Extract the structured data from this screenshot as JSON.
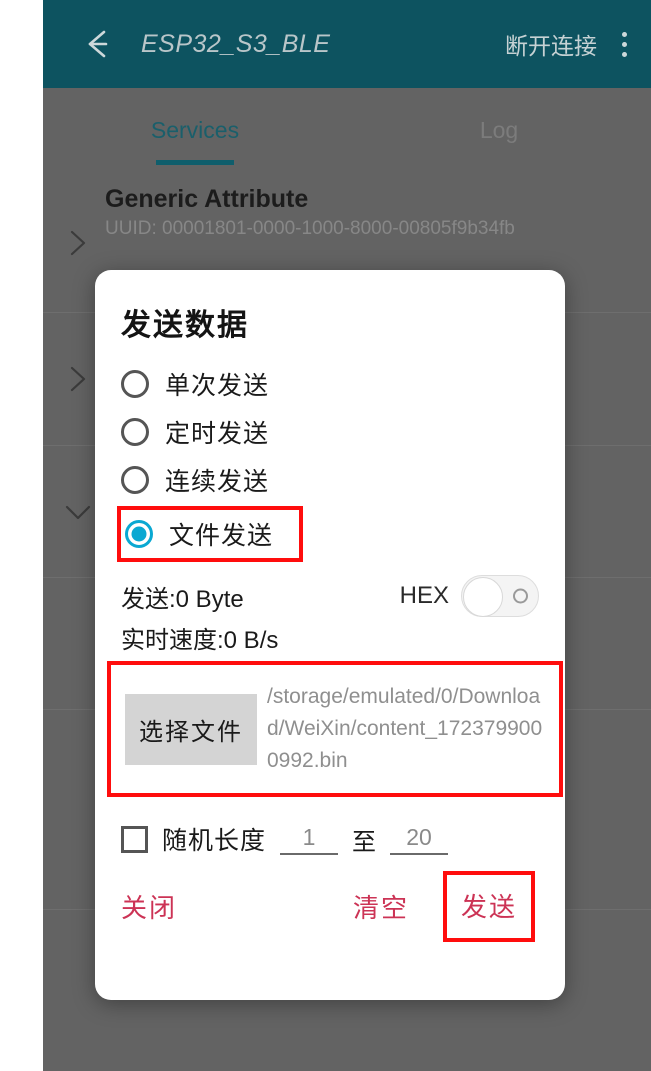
{
  "appbar": {
    "back_icon": "arrow-left-icon",
    "title": "ESP32_S3_BLE",
    "action_label": "断开连接",
    "overflow_icon": "more-vertical-icon"
  },
  "tabs": [
    {
      "label": "Services",
      "active": true
    },
    {
      "label": "Log",
      "active": false
    }
  ],
  "services": [
    {
      "name": "Generic Attribute",
      "uuid": "UUID: 00001801-0000-1000-8000-00805f9b34fb",
      "chevron": "chevron-right-icon"
    },
    {
      "name": "",
      "uuid": "",
      "chevron": "chevron-right-icon"
    },
    {
      "name": "",
      "uuid": "",
      "chevron": "chevron-down-icon"
    },
    {
      "name": "",
      "uuid": "",
      "chevron": ""
    }
  ],
  "dialog": {
    "title": "发送数据",
    "modes": [
      {
        "label": "单次发送",
        "selected": false
      },
      {
        "label": "定时发送",
        "selected": false
      },
      {
        "label": "连续发送",
        "selected": false
      },
      {
        "label": "文件发送",
        "selected": true
      }
    ],
    "sent_label": "发送:0 Byte",
    "hex_label": "HEX",
    "hex_enabled": false,
    "speed_label": "实时速度:0 B/s",
    "file_picker_label": "选择文件",
    "file_path": "/storage/emulated/0/Download/WeiXin/content_1723799000992.bin",
    "random_length_label": "随机长度",
    "random_length_checked": false,
    "random_min": "1",
    "random_to": "至",
    "random_max": "20",
    "close_label": "关闭",
    "clear_label": "清空",
    "send_label": "发送"
  },
  "colors": {
    "appbar": "#0d5360",
    "scrim": "#636363",
    "tab_active": "#1a5f6b",
    "radio_selected": "#0aa8d2",
    "action_text": "#cc3355",
    "highlight": "#ff0d0d"
  }
}
